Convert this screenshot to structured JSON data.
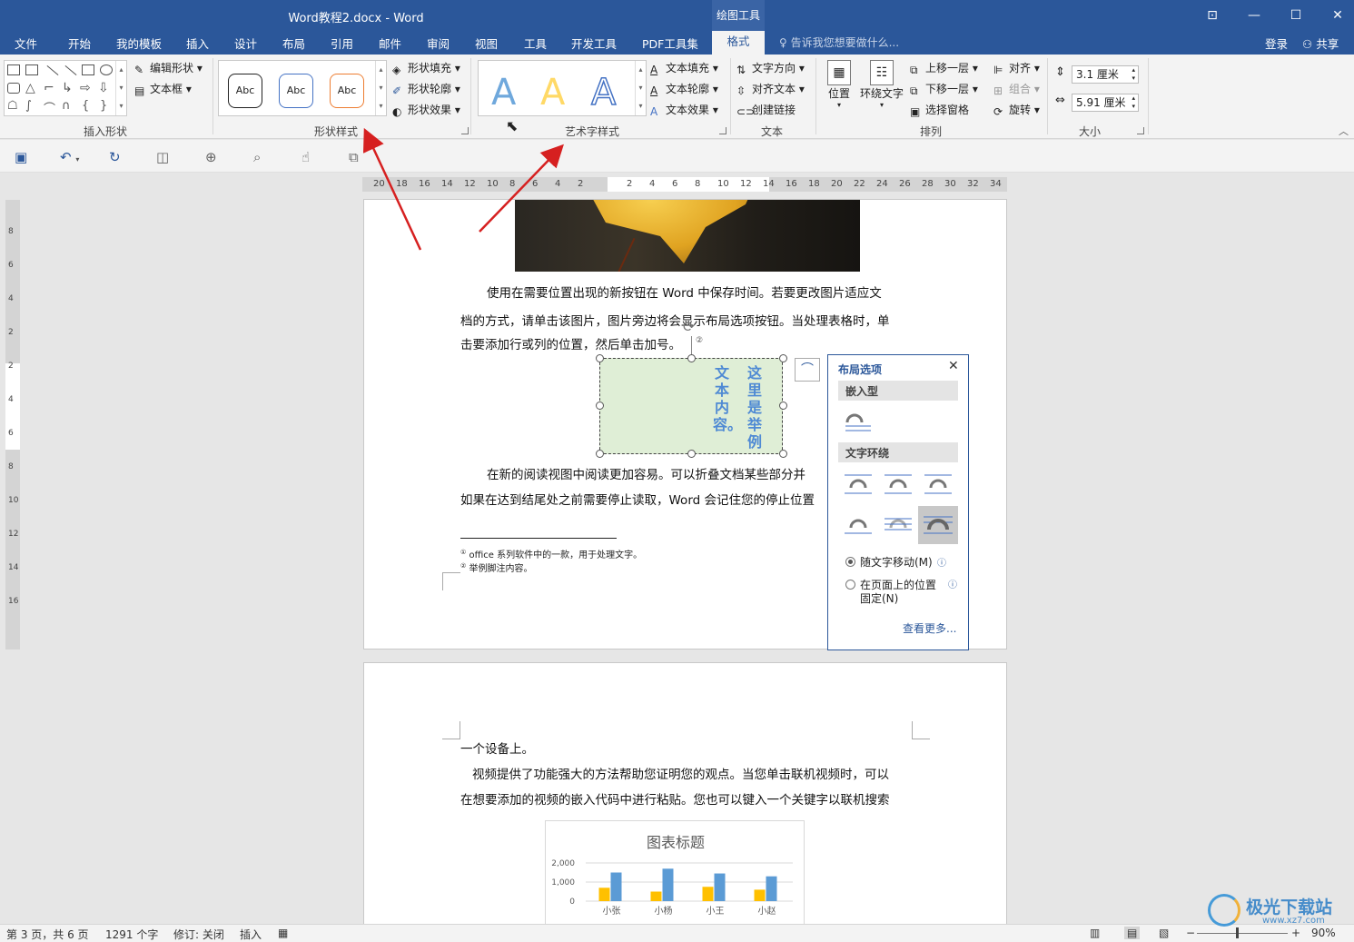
{
  "window": {
    "title": "Word教程2.docx - Word",
    "context_tab_group": "绘图工具"
  },
  "tabs": [
    "文件",
    "开始",
    "我的模板",
    "插入",
    "设计",
    "布局",
    "引用",
    "邮件",
    "审阅",
    "视图",
    "工具",
    "开发工具",
    "PDF工具集",
    "格式"
  ],
  "tell_me": "告诉我您想要做什么...",
  "account": {
    "login": "登录",
    "share": "共享"
  },
  "ribbon": {
    "insert_shape": {
      "label": "插入形状",
      "edit_shape": "编辑形状",
      "text_box": "文本框"
    },
    "shape_styles": {
      "label": "形状样式",
      "sample": "Abc",
      "fill": "形状填充",
      "outline": "形状轮廓",
      "effects": "形状效果"
    },
    "wordart_styles": {
      "label": "艺术字样式",
      "sample": "A",
      "text_fill": "文本填充",
      "text_outline": "文本轮廓",
      "text_effects": "文本效果"
    },
    "text": {
      "label": "文本",
      "direction": "文字方向",
      "align": "对齐文本",
      "link": "创建链接"
    },
    "arrange": {
      "label": "排列",
      "position": "位置",
      "wrap": "环绕文字",
      "forward": "上移一层",
      "backward": "下移一层",
      "pane": "选择窗格",
      "align": "对齐",
      "group": "组合",
      "rotate": "旋转"
    },
    "size": {
      "label": "大小",
      "height": "3.1 厘米",
      "width": "5.91 厘米"
    }
  },
  "ruler": {
    "left": [
      "20",
      "18",
      "16",
      "14",
      "12",
      "10",
      "8",
      "6",
      "4",
      "2"
    ],
    "right": [
      "2",
      "4",
      "6",
      "8",
      "10",
      "12",
      "14",
      "16",
      "18",
      "20",
      "22",
      "24",
      "26",
      "28",
      "30",
      "32",
      "34"
    ],
    "vertical": [
      "8",
      "6",
      "4",
      "2",
      "2",
      "4",
      "6",
      "8",
      "10",
      "12",
      "14",
      "16"
    ]
  },
  "document": {
    "p1": "使用在需要位置出现的新按钮在 Word 中保存时间。若要更改图片适应文",
    "p2": "档的方式，请单击该图片，图片旁边将会显示布局选项按钮。当处理表格时，单",
    "p3": "击要添加行或列的位置，然后单击加号。",
    "textbox_col1": "这里是举例",
    "textbox_col2": "文本内容。",
    "p4": "在新的阅读视图中阅读更加容易。可以折叠文档某些部分并",
    "p5": "如果在达到结尾处之前需要停止读取，Word 会记住您的停止位置",
    "footnote1_mark": "①",
    "footnote1": "office 系列软件中的一款，用于处理文字。",
    "footnote2_mark": "②",
    "footnote2": "举例脚注内容。",
    "p6": "一个设备上。",
    "p7": "视频提供了功能强大的方法帮助您证明您的观点。当您单击联机视频时，可以",
    "p8": "在想要添加的视频的嵌入代码中进行粘贴。您也可以键入一个关键字以联机搜索"
  },
  "layout_options": {
    "title": "布局选项",
    "inline": "嵌入型",
    "wrap": "文字环绕",
    "move_with_text": "随文字移动(M)",
    "fix_position": "在页面上的位置",
    "fix_position2": "固定(N)",
    "see_more": "查看更多..."
  },
  "chart_data": {
    "type": "bar",
    "title": "图表标题",
    "categories": [
      "小张",
      "小杨",
      "小王",
      "小赵"
    ],
    "series": [
      {
        "values": [
          700,
          500,
          750,
          600
        ],
        "color": "#ffc000"
      },
      {
        "values": [
          1500,
          1700,
          1450,
          1300
        ],
        "color": "#5b9bd5"
      }
    ],
    "yticks": [
      "2,000",
      "1,000",
      "0"
    ],
    "ylim": [
      0,
      2000
    ]
  },
  "status": {
    "page": "第 3 页，共 6 页",
    "words": "1291 个字",
    "track": "修订: 关闭",
    "mode": "插入",
    "zoom": "90%"
  },
  "watermark": {
    "text": "极光下载站",
    "url": "www.xz7.com"
  },
  "colors": {
    "ribbon_blue": "#2b579a",
    "accent_arrow": "#d62020",
    "textbox_fill": "#dfeed6",
    "wordart_blue": "#4f8ad4"
  }
}
